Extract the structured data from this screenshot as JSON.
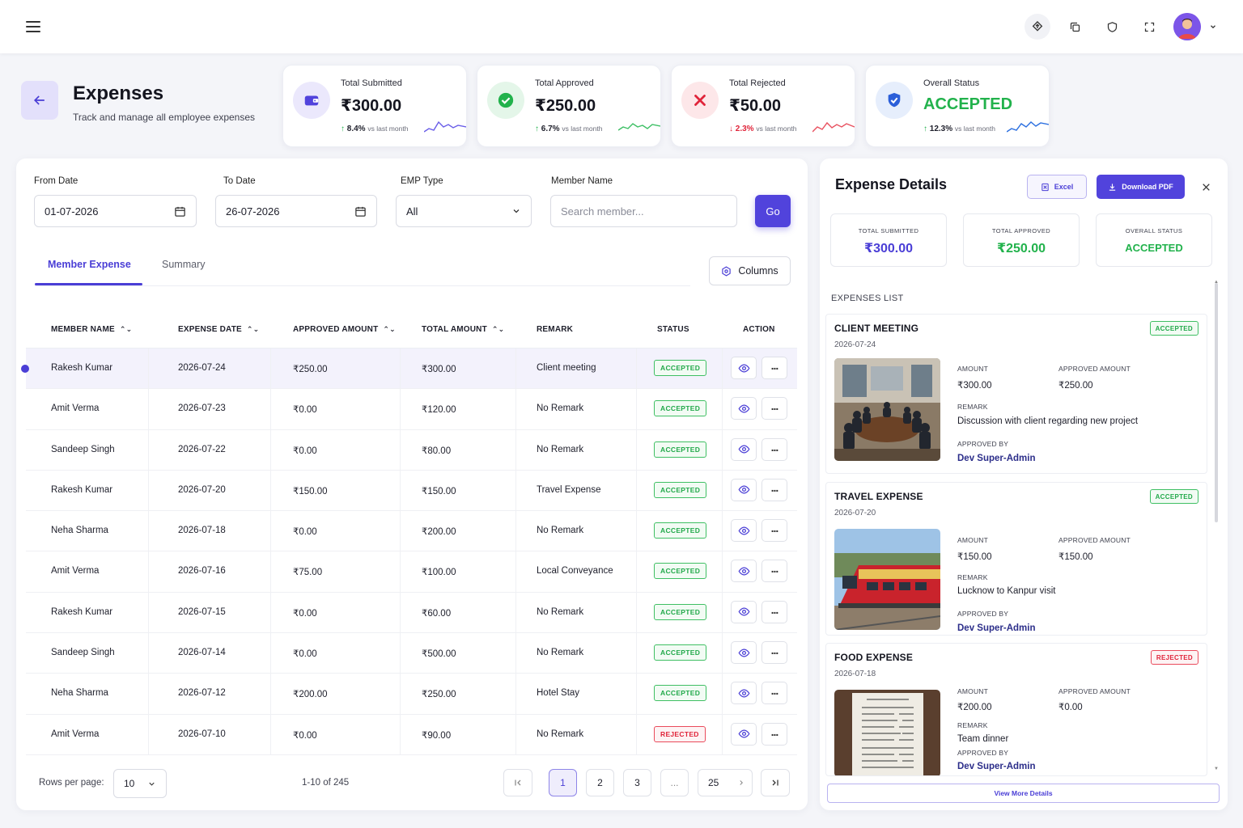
{
  "header": {
    "title": "Expenses",
    "subtitle": "Track and manage all employee expenses"
  },
  "stats": [
    {
      "label": "Total Submitted",
      "value": "₹300.00",
      "change": "8.4%",
      "change_suffix": "vs last month",
      "direction": "up",
      "icon": "wallet-icon",
      "color": "#5143dc"
    },
    {
      "label": "Total Approved",
      "value": "₹250.00",
      "change": "6.7%",
      "change_suffix": "vs last month",
      "direction": "up",
      "icon": "check-circle-icon",
      "color": "#22b24c"
    },
    {
      "label": "Total Rejected",
      "value": "₹50.00",
      "change": "2.3%",
      "change_suffix": "vs last month",
      "direction": "down",
      "icon": "x-icon",
      "color": "#e0243a"
    },
    {
      "label": "Overall Status",
      "value": "ACCEPTED",
      "change": "12.3%",
      "change_suffix": "vs last month",
      "direction": "up",
      "icon": "shield-check-icon",
      "color": "#2b5fd9"
    }
  ],
  "filters": {
    "from_label": "From Date",
    "from_value": "01-07-2026",
    "to_label": "To Date",
    "to_value": "26-07-2026",
    "emp_label": "EMP Type",
    "emp_value": "All",
    "member_label": "Member Name",
    "member_placeholder": "Search member...",
    "go_label": "Go"
  },
  "tabs": [
    {
      "label": "Member Expense",
      "active": true
    },
    {
      "label": "Summary",
      "active": false
    }
  ],
  "columns_label": "Columns",
  "table": {
    "headers": [
      "MEMBER NAME",
      "EXPENSE DATE",
      "APPROVED AMOUNT",
      "TOTAL AMOUNT",
      "REMARK",
      "STATUS",
      "ACTION"
    ],
    "rows": [
      {
        "name": "Rakesh Kumar",
        "date": "2026-07-24",
        "approved": "₹250.00",
        "total": "₹300.00",
        "remark": "Client meeting",
        "status": "ACCEPTED"
      },
      {
        "name": "Amit Verma",
        "date": "2026-07-23",
        "approved": "₹0.00",
        "total": "₹120.00",
        "remark": "No Remark",
        "status": "ACCEPTED"
      },
      {
        "name": "Sandeep Singh",
        "date": "2026-07-22",
        "approved": "₹0.00",
        "total": "₹80.00",
        "remark": "No Remark",
        "status": "ACCEPTED"
      },
      {
        "name": "Rakesh Kumar",
        "date": "2026-07-20",
        "approved": "₹150.00",
        "total": "₹150.00",
        "remark": "Travel Expense",
        "status": "ACCEPTED"
      },
      {
        "name": "Neha Sharma",
        "date": "2026-07-18",
        "approved": "₹0.00",
        "total": "₹200.00",
        "remark": "No Remark",
        "status": "ACCEPTED"
      },
      {
        "name": "Amit Verma",
        "date": "2026-07-16",
        "approved": "₹75.00",
        "total": "₹100.00",
        "remark": "Local Conveyance",
        "status": "ACCEPTED"
      },
      {
        "name": "Rakesh Kumar",
        "date": "2026-07-15",
        "approved": "₹0.00",
        "total": "₹60.00",
        "remark": "No Remark",
        "status": "ACCEPTED"
      },
      {
        "name": "Sandeep Singh",
        "date": "2026-07-14",
        "approved": "₹0.00",
        "total": "₹500.00",
        "remark": "No Remark",
        "status": "ACCEPTED"
      },
      {
        "name": "Neha Sharma",
        "date": "2026-07-12",
        "approved": "₹200.00",
        "total": "₹250.00",
        "remark": "Hotel Stay",
        "status": "ACCEPTED"
      },
      {
        "name": "Amit Verma",
        "date": "2026-07-10",
        "approved": "₹0.00",
        "total": "₹90.00",
        "remark": "No Remark",
        "status": "REJECTED"
      }
    ]
  },
  "pagination": {
    "rows_label": "Rows per page:",
    "rows_value": "10",
    "range": "1-10 of 245",
    "pages": [
      "1",
      "2",
      "3",
      "...",
      "25"
    ],
    "active_page": "1"
  },
  "details": {
    "title": "Expense Details",
    "excel_label": "Excel",
    "pdf_label": "Download PDF",
    "summary": [
      {
        "label": "TOTAL SUBMITTED",
        "value": "₹300.00",
        "color": "#4a3ed6"
      },
      {
        "label": "TOTAL APPROVED",
        "value": "₹250.00",
        "color": "#22b24c"
      },
      {
        "label": "OVERALL STATUS",
        "value": "ACCEPTED",
        "color": "#22b24c"
      }
    ],
    "list_label": "EXPENSES LIST",
    "amount_label": "AMOUNT",
    "approved_amount_label": "APPROVED AMOUNT",
    "remark_label": "REMARK",
    "approved_by_label": "APPROVED BY",
    "items": [
      {
        "title": "CLIENT MEETING",
        "date": "2026-07-24",
        "status": "ACCEPTED",
        "amount": "₹300.00",
        "approved": "₹250.00",
        "remark": "Discussion with client regarding new project",
        "approved_by": "Dev Super-Admin",
        "image": "meeting-room-photo"
      },
      {
        "title": "TRAVEL EXPENSE",
        "date": "2026-07-20",
        "status": "ACCEPTED",
        "amount": "₹150.00",
        "approved": "₹150.00",
        "remark": "Lucknow to Kanpur visit",
        "approved_by": "Dev Super-Admin",
        "image": "train-photo"
      },
      {
        "title": "FOOD EXPENSE",
        "date": "2026-07-18",
        "status": "REJECTED",
        "amount": "₹200.00",
        "approved": "₹0.00",
        "remark": "Team dinner",
        "approved_by": "Dev Super-Admin",
        "image": "receipt-photo"
      }
    ],
    "view_more_label": "View More Details"
  }
}
